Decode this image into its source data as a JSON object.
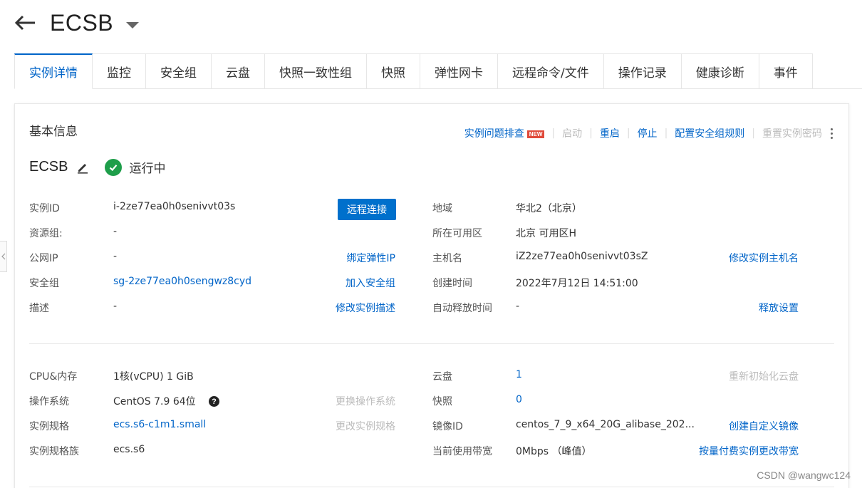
{
  "header": {
    "title": "ECSB"
  },
  "tabs": [
    "实例详情",
    "监控",
    "安全组",
    "云盘",
    "快照一致性组",
    "快照",
    "弹性网卡",
    "远程命令/文件",
    "操作记录",
    "健康诊断",
    "事件"
  ],
  "panel": {
    "title": "基本信息",
    "actions": {
      "troubleshoot": "实例问题排查",
      "new_badge": "NEW",
      "start": "启动",
      "restart": "重启",
      "stop": "停止",
      "config_security": "配置安全组规则",
      "reset_password": "重置实例密码"
    },
    "instance": {
      "name": "ECSB",
      "status": "运行中"
    },
    "basic": {
      "instance_id_label": "实例ID",
      "instance_id": "i-2ze77ea0h0senivvt03s",
      "connect_button": "远程连接",
      "resource_group_label": "资源组:",
      "resource_group": "-",
      "public_ip_label": "公网IP",
      "public_ip": "-",
      "bind_eip": "绑定弹性IP",
      "security_group_label": "安全组",
      "security_group": "sg-2ze77ea0h0sengwz8cyd",
      "join_security_group": "加入安全组",
      "description_label": "描述",
      "description": "-",
      "edit_description": "修改实例描述",
      "region_label": "地域",
      "region": "华北2（北京）",
      "zone_label": "所在可用区",
      "zone": "北京 可用区H",
      "hostname_label": "主机名",
      "hostname": "iZ2ze77ea0h0senivvt03sZ",
      "edit_hostname": "修改实例主机名",
      "created_label": "创建时间",
      "created": "2022年7月12日 14:51:00",
      "auto_release_label": "自动释放时间",
      "auto_release": "-",
      "release_settings": "释放设置"
    },
    "config": {
      "cpu_mem_label": "CPU&内存",
      "cpu_mem": "1核(vCPU) 1 GiB",
      "os_label": "操作系统",
      "os": "CentOS 7.9 64位",
      "change_os": "更换操作系统",
      "spec_label": "实例规格",
      "spec": "ecs.s6-c1m1.small",
      "change_spec": "更改实例规格",
      "family_label": "实例规格族",
      "family": "ecs.s6",
      "disk_label": "云盘",
      "disk": "1",
      "reinit_disk": "重新初始化云盘",
      "snapshot_label": "快照",
      "snapshot": "0",
      "image_label": "镜像ID",
      "image": "centos_7_9_x64_20G_alibase_202...",
      "create_image": "创建自定义镜像",
      "bandwidth_label": "当前使用带宽",
      "bandwidth": "0Mbps （峰值）",
      "change_bandwidth": "按量付费实例更改带宽"
    }
  },
  "watermark": "CSDN @wangwc124"
}
